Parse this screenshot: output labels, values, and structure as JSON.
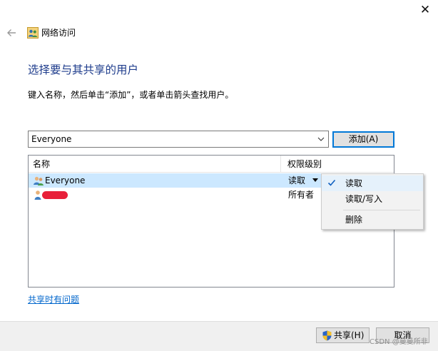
{
  "window": {
    "title": "网络访问",
    "close_glyph": "✕"
  },
  "icons": {
    "back": "arrow-left-icon",
    "title": "users-group-icon",
    "dropdown": "chevron-down-icon",
    "check": "checkmark-icon",
    "shield": "uac-shield-icon"
  },
  "page": {
    "heading": "选择要与其共享的用户",
    "instruction": "键入名称，然后单击“添加”，或者单击箭头查找用户。"
  },
  "name_input": {
    "value": "Everyone"
  },
  "add_button": {
    "label": "添加(A)"
  },
  "list": {
    "columns": [
      "名称",
      "权限级别"
    ],
    "rows": [
      {
        "name": "Everyone",
        "permission": "读取",
        "selected": true
      },
      {
        "name": "",
        "permission": "所有者",
        "selected": false
      }
    ]
  },
  "permission_menu": {
    "items": [
      "读取",
      "读取/写入",
      "删除"
    ],
    "checked_item": "读取"
  },
  "link": {
    "label": "共享时有问题"
  },
  "footer": {
    "share_label": "共享(H)",
    "cancel_label": "取消"
  },
  "watermark": "CSDN @曼曼所非",
  "colors": {
    "accent": "#0078d7",
    "heading": "#1e3c8c",
    "selection": "#cce8ff",
    "link": "#0066cc",
    "redaction": "#e8203a"
  }
}
